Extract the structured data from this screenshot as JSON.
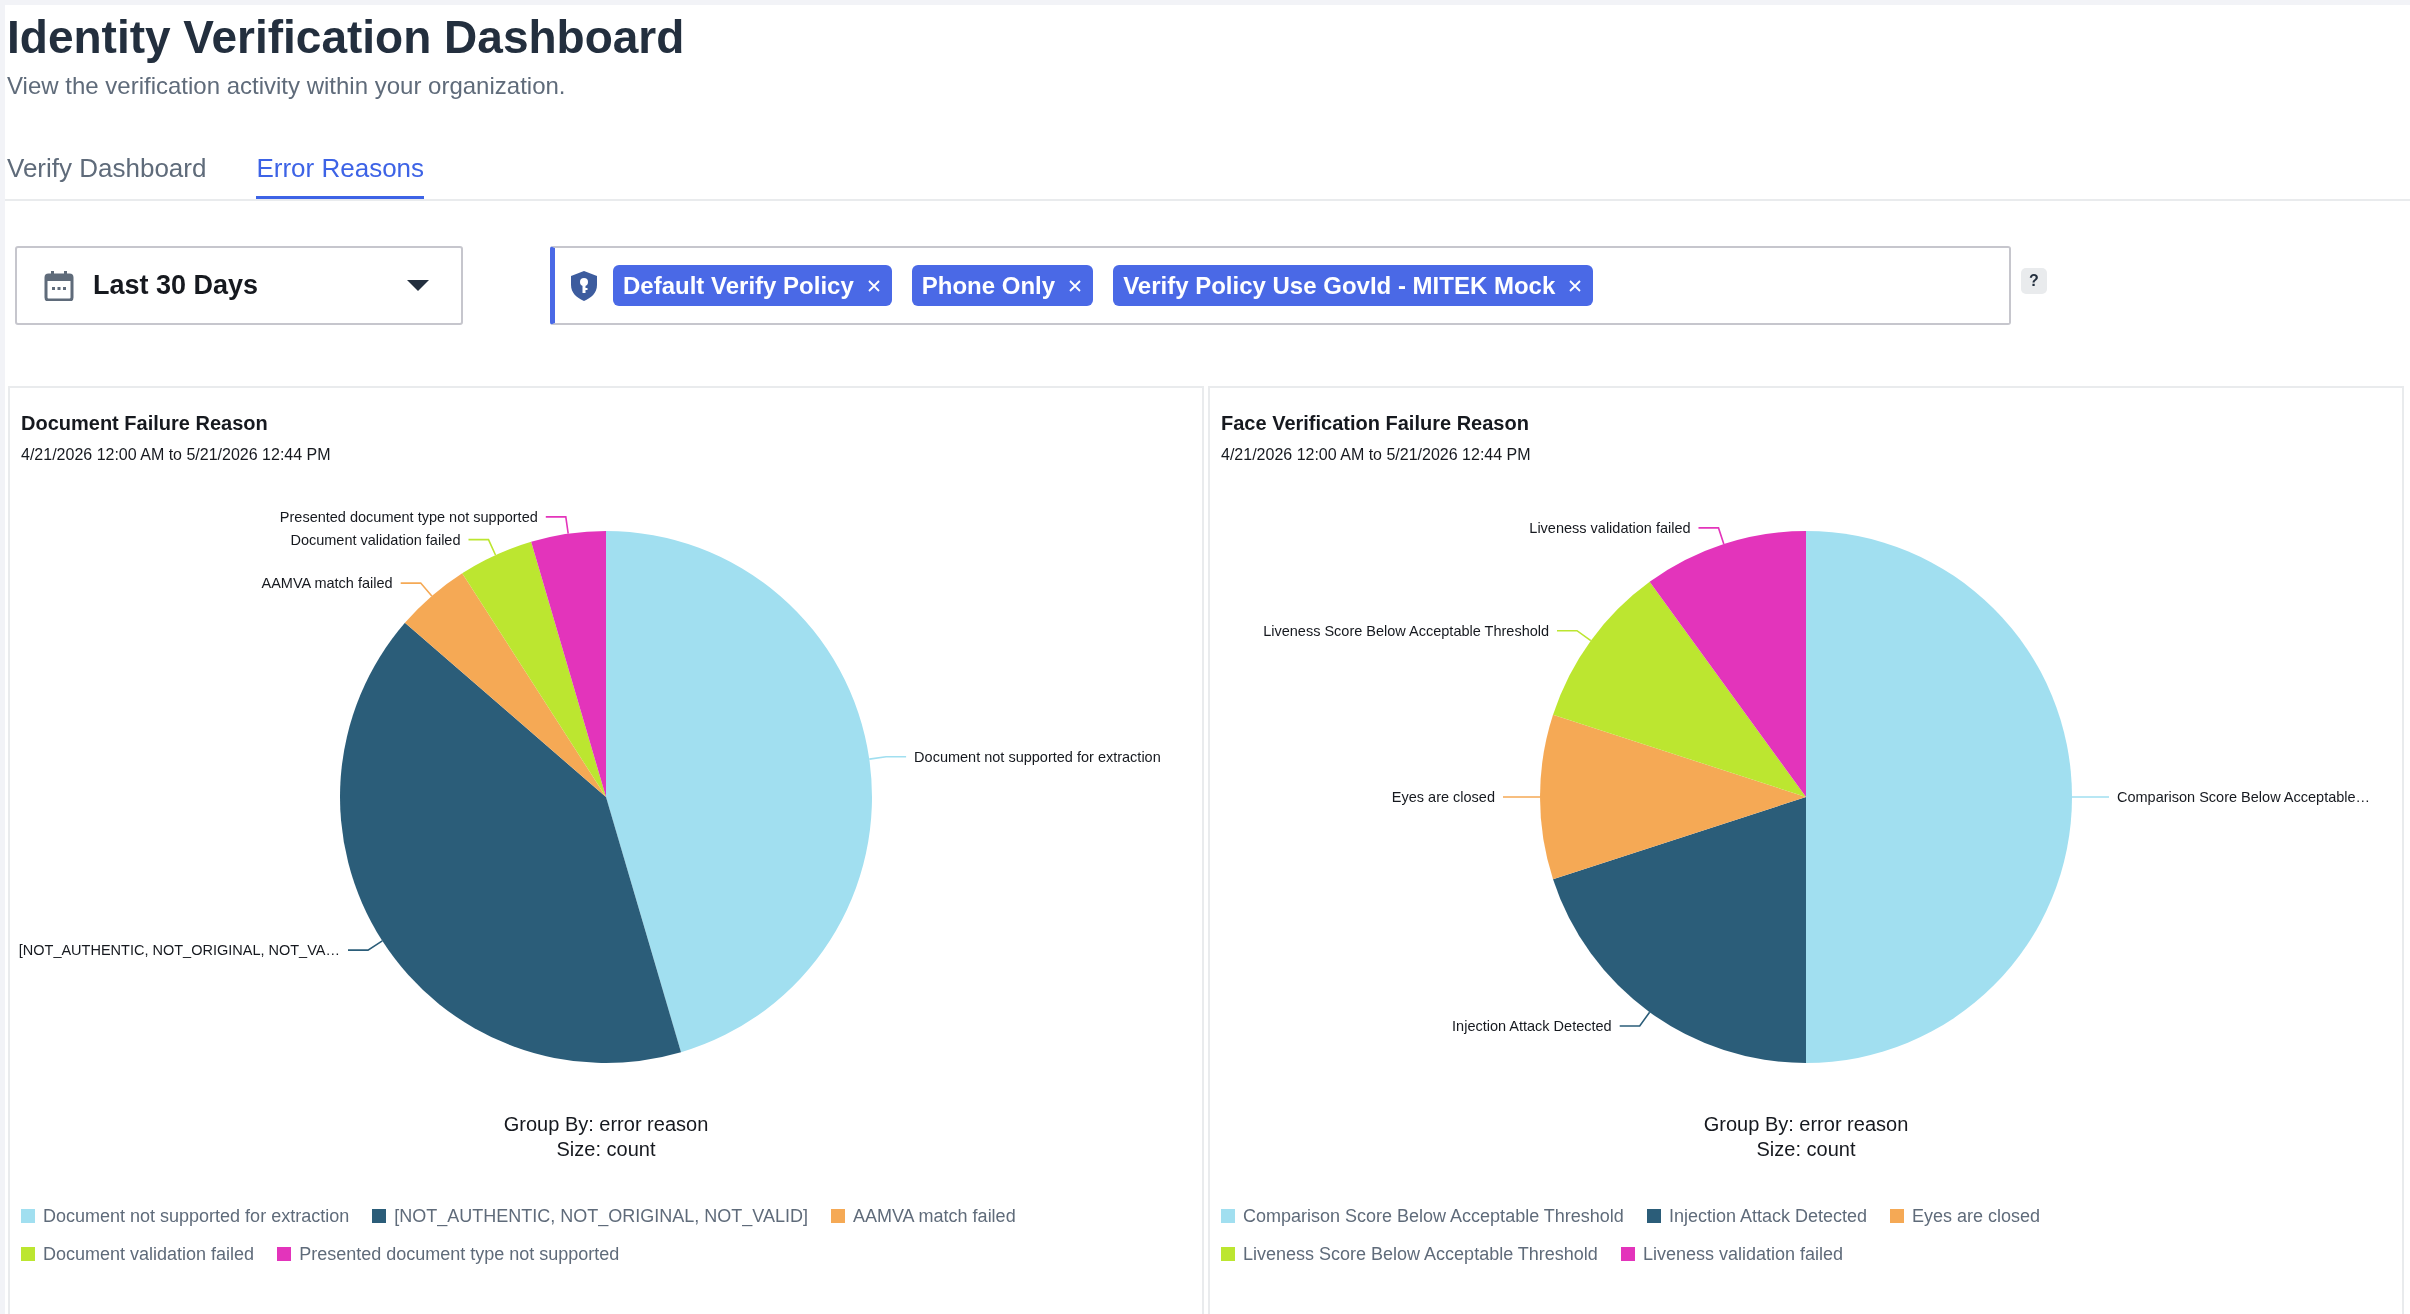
{
  "page": {
    "title": "Identity Verification Dashboard",
    "subtitle": "View the verification activity within your organization."
  },
  "tabs": [
    {
      "label": "Verify Dashboard",
      "selected": false
    },
    {
      "label": "Error Reasons",
      "selected": true
    }
  ],
  "filters": {
    "date_range": "Last 30 Days",
    "policies": [
      "Default Verify Policy",
      "Phone Only",
      "Verify Policy Use GovId - MITEK Mock"
    ],
    "help": "?"
  },
  "charts": [
    {
      "title": "Document Failure Reason",
      "date_range": "4/21/2026 12:00 AM to 5/21/2026 12:44 PM",
      "chart_data": {
        "type": "pie",
        "categories": [
          "Document not supported for extraction",
          "[NOT_AUTHENTIC, NOT_ORIGINAL, NOT_VA…",
          "AAMVA match failed",
          "Document validation failed",
          "Presented document type not supported"
        ],
        "values": [
          45.45,
          40.91,
          4.55,
          4.55,
          4.54
        ]
      },
      "caption": [
        "Group By: error reason",
        "Size: count"
      ],
      "legend": [
        {
          "label": "Document not supported for extraction",
          "color": "#a1dff0"
        },
        {
          "label": "[NOT_AUTHENTIC, NOT_ORIGINAL, NOT_VALID]",
          "color": "#2b5d79"
        },
        {
          "label": "AAMVA match failed",
          "color": "#f5a955"
        },
        {
          "label": "Document validation failed",
          "color": "#bce630"
        },
        {
          "label": "Presented document type not supported",
          "color": "#e334bb"
        }
      ]
    },
    {
      "title": "Face Verification Failure Reason",
      "date_range": "4/21/2026 12:00 AM to 5/21/2026 12:44 PM",
      "chart_data": {
        "type": "pie",
        "categories": [
          "Comparison Score Below Acceptable…",
          "Injection Attack Detected",
          "Eyes are closed",
          "Liveness Score Below Acceptable Threshold",
          "Liveness validation failed"
        ],
        "values": [
          50,
          20,
          10,
          10,
          10
        ]
      },
      "caption": [
        "Group By: error reason",
        "Size: count"
      ],
      "legend": [
        {
          "label": "Comparison Score Below Acceptable Threshold",
          "color": "#a1dff0"
        },
        {
          "label": "Injection Attack Detected",
          "color": "#2b5d79"
        },
        {
          "label": "Eyes are closed",
          "color": "#f5a955"
        },
        {
          "label": "Liveness Score Below Acceptable Threshold",
          "color": "#bce630"
        },
        {
          "label": "Liveness validation failed",
          "color": "#e334bb"
        }
      ]
    }
  ]
}
